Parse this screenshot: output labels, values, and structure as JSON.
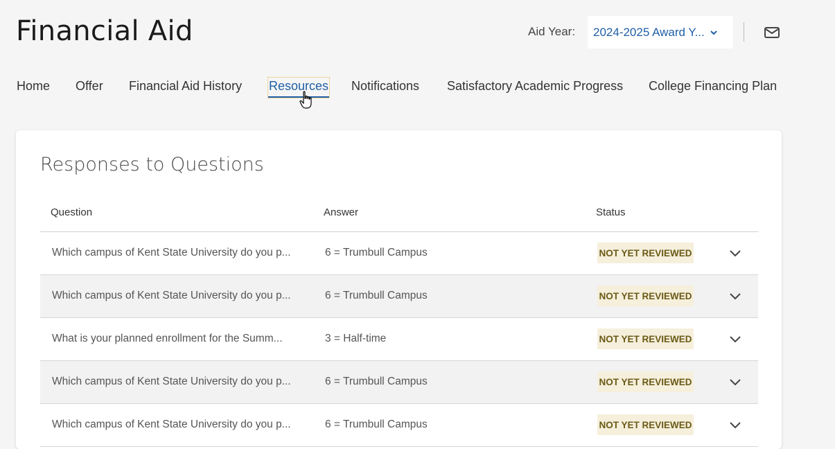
{
  "header": {
    "title": "Financial Aid",
    "aid_year_label": "Aid Year:",
    "aid_year_value": "2024-2025 Award Y...",
    "icons": {
      "select": "chevron-down-icon",
      "mail": "mail-icon"
    }
  },
  "nav": {
    "items": [
      {
        "label": "Home"
      },
      {
        "label": "Offer"
      },
      {
        "label": "Financial Aid History"
      },
      {
        "label": "Resources"
      },
      {
        "label": "Notifications"
      },
      {
        "label": "Satisfactory Academic Progress"
      },
      {
        "label": "College Financing Plan"
      }
    ],
    "active": "Resources"
  },
  "card": {
    "title": "Responses to Questions",
    "columns": {
      "question": "Question",
      "answer": "Answer",
      "status": "Status"
    },
    "rows": [
      {
        "question": "Which campus of Kent State University do you p...",
        "answer": "6 = Trumbull Campus",
        "status": "NOT YET REVIEWED"
      },
      {
        "question": "Which campus of Kent State University do you p...",
        "answer": "6 = Trumbull Campus",
        "status": "NOT YET REVIEWED"
      },
      {
        "question": "What is your planned enrollment for the Summ...",
        "answer": "3 = Half-time",
        "status": "NOT YET REVIEWED"
      },
      {
        "question": "Which campus of Kent State University do you p...",
        "answer": "6 = Trumbull Campus",
        "status": "NOT YET REVIEWED"
      },
      {
        "question": "Which campus of Kent State University do you p...",
        "answer": "6 = Trumbull Campus",
        "status": "NOT YET REVIEWED"
      }
    ]
  },
  "colors": {
    "link": "#1f5fa6",
    "badge_bg": "#f5efdc",
    "badge_text": "#6b5a16",
    "page_bg": "#f5f5f5"
  }
}
